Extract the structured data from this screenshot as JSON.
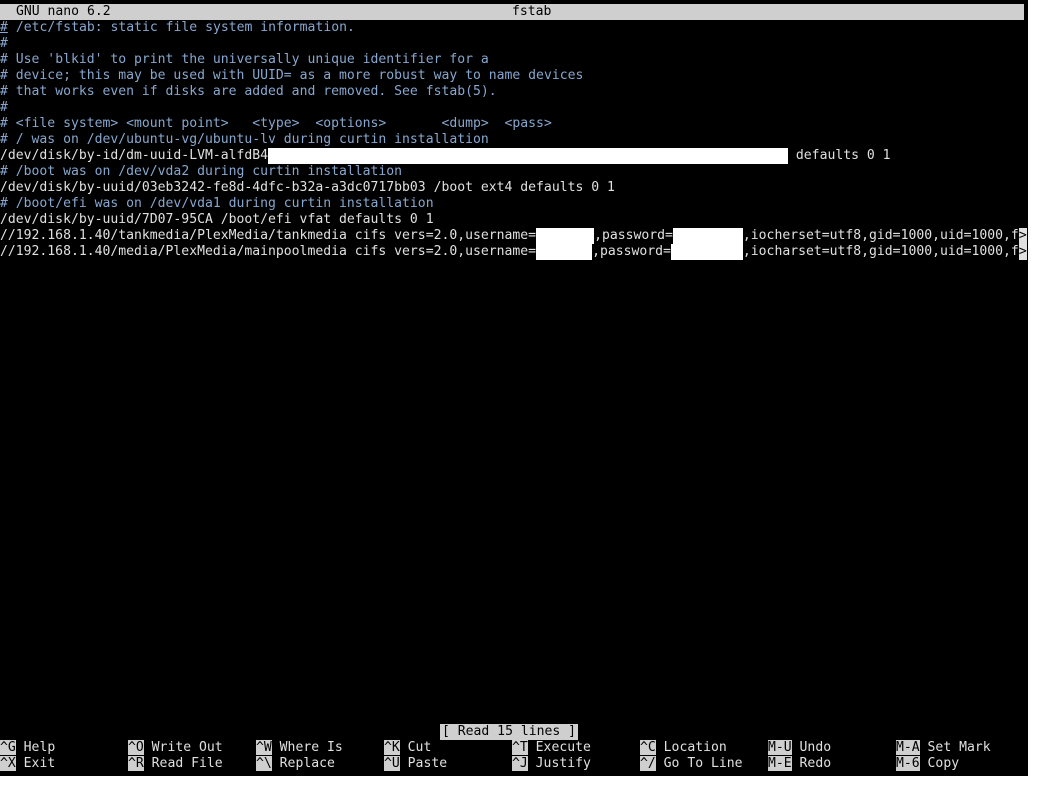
{
  "titlebar": {
    "app": "GNU nano 6.2",
    "filename": "fstab"
  },
  "lines": [
    {
      "kind": "comment",
      "text": " /etc/fstab: static file system information."
    },
    {
      "kind": "comment",
      "text": ""
    },
    {
      "kind": "comment",
      "text": " Use 'blkid' to print the universally unique identifier for a"
    },
    {
      "kind": "comment",
      "text": " device; this may be used with UUID= as a more robust way to name devices"
    },
    {
      "kind": "comment",
      "text": " that works even if disks are added and removed. See fstab(5)."
    },
    {
      "kind": "comment",
      "text": ""
    },
    {
      "kind": "comment",
      "text": " <file system> <mount point>   <type>  <options>       <dump>  <pass>"
    },
    {
      "kind": "comment",
      "text": " / was on /dev/ubuntu-vg/ubuntu-lv during curtin installation"
    },
    {
      "kind": "plain",
      "text_a": "/dev/disk/by-id/dm-uuid-LVM-alfdB4",
      "text_b": " defaults 0 1"
    },
    {
      "kind": "comment",
      "text": " /boot was on /dev/vda2 during curtin installation"
    },
    {
      "kind": "plain1",
      "text": "/dev/disk/by-uuid/03eb3242-fe8d-4dfc-b32a-a3dc0717bb03 /boot ext4 defaults 0 1"
    },
    {
      "kind": "comment",
      "text": " /boot/efi was on /dev/vda1 during curtin installation"
    },
    {
      "kind": "plain1",
      "text": "/dev/disk/by-uuid/7D07-95CA /boot/efi vfat defaults 0 1"
    },
    {
      "kind": "cifs",
      "text_a": "//192.168.1.40/tankmedia/PlexMedia/tankmedia cifs vers=2.0,username=",
      "text_b": ",password=",
      "text_c": ",iocherset=utf8,gid=1000,uid=1000,f"
    },
    {
      "kind": "cifs",
      "text_a": "//192.168.1.40/media/PlexMedia/mainpoolmedia cifs vers=2.0,username=",
      "text_b": ",password=",
      "text_c": ",iocharset=utf8,gid=1000,uid=1000,f"
    }
  ],
  "overflow_marker": ">",
  "status": "[ Read 15 lines ]",
  "shortcuts": [
    {
      "key": "^G",
      "label": "Help"
    },
    {
      "key": "^X",
      "label": "Exit"
    },
    {
      "key": "^O",
      "label": "Write Out"
    },
    {
      "key": "^R",
      "label": "Read File"
    },
    {
      "key": "^W",
      "label": "Where Is"
    },
    {
      "key": "^\\",
      "label": "Replace"
    },
    {
      "key": "^K",
      "label": "Cut"
    },
    {
      "key": "^U",
      "label": "Paste"
    },
    {
      "key": "^T",
      "label": "Execute"
    },
    {
      "key": "^J",
      "label": "Justify"
    },
    {
      "key": "^C",
      "label": "Location"
    },
    {
      "key": "^/",
      "label": "Go To Line"
    },
    {
      "key": "M-U",
      "label": "Undo"
    },
    {
      "key": "M-E",
      "label": "Redo"
    },
    {
      "key": "M-A",
      "label": "Set Mark"
    },
    {
      "key": "M-6",
      "label": "Copy"
    }
  ],
  "colors": {
    "comment": "#86a7cf",
    "text": "#e0e0e0",
    "bar": "#cfcfcf",
    "background": "#000000"
  }
}
